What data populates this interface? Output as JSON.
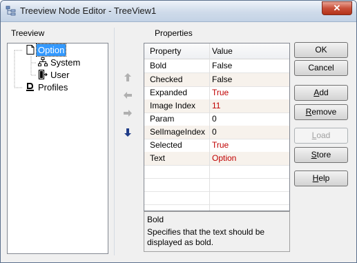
{
  "window": {
    "title": "Treeview Node Editor - TreeView1",
    "close_glyph": "✕"
  },
  "treeview": {
    "label": "Treeview",
    "nodes": [
      {
        "label": "Option",
        "icon": "document-icon",
        "selected": true,
        "level": 0
      },
      {
        "label": "System",
        "icon": "network-icon",
        "selected": false,
        "level": 1
      },
      {
        "label": "User",
        "icon": "user-door-icon",
        "selected": false,
        "level": 1
      },
      {
        "label": "Profiles",
        "icon": "profile-icon",
        "selected": false,
        "level": 0
      }
    ]
  },
  "properties": {
    "label": "Properties",
    "header": {
      "property": "Property",
      "value": "Value"
    },
    "rows": [
      {
        "property": "Bold",
        "value": "False",
        "modified": false
      },
      {
        "property": "Checked",
        "value": "False",
        "modified": false
      },
      {
        "property": "Expanded",
        "value": "True",
        "modified": true
      },
      {
        "property": "Image Index",
        "value": "11",
        "modified": true
      },
      {
        "property": "Param",
        "value": "0",
        "modified": false
      },
      {
        "property": "SelImageIndex",
        "value": "0",
        "modified": false
      },
      {
        "property": "Selected",
        "value": "True",
        "modified": true
      },
      {
        "property": "Text",
        "value": "Option",
        "modified": true
      }
    ],
    "description": {
      "title": "Bold",
      "text": "Specifies that the text should be displayed as bold."
    }
  },
  "buttons": {
    "ok": {
      "pre": "",
      "key": "",
      "post": "OK"
    },
    "cancel": {
      "pre": "",
      "key": "",
      "post": "Cancel"
    },
    "add": {
      "pre": "",
      "key": "A",
      "post": "dd"
    },
    "remove": {
      "pre": "",
      "key": "R",
      "post": "emove"
    },
    "load": {
      "pre": "",
      "key": "L",
      "post": "oad"
    },
    "store": {
      "pre": "",
      "key": "S",
      "post": "tore"
    },
    "help": {
      "pre": "",
      "key": "H",
      "post": "elp"
    }
  },
  "colors": {
    "accent": "#3399ff",
    "modified_value": "#c00000",
    "arrow_active": "#1f3c88",
    "arrow_inactive": "#b0b0b0"
  }
}
